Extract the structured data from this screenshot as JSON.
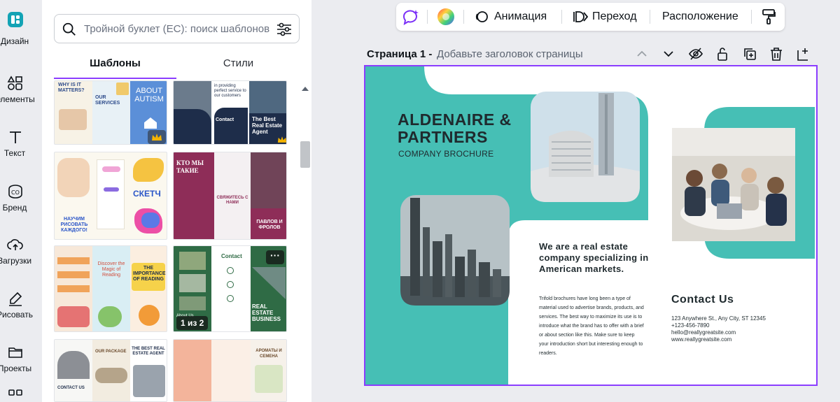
{
  "sidebar": {
    "items": [
      {
        "label": "Дизайн",
        "icon": "design-icon"
      },
      {
        "label": "Элементы",
        "icon": "elements-icon"
      },
      {
        "label": "Текст",
        "icon": "text-icon"
      },
      {
        "label": "Бренд",
        "icon": "brand-icon"
      },
      {
        "label": "Загрузки",
        "icon": "uploads-icon"
      },
      {
        "label": "Рисовать",
        "icon": "draw-icon"
      },
      {
        "label": "Проекты",
        "icon": "projects-icon"
      },
      {
        "label": "",
        "icon": "apps-icon"
      }
    ]
  },
  "panel": {
    "search_placeholder": "Тройной буклет (ЕС): поиск шаблонов",
    "tabs": [
      "Шаблоны",
      "Стили"
    ],
    "templates": [
      {
        "title": "ABOUT AUTISM",
        "lines": [
          "WHY IS IT MATTERS?",
          "OUR SERVICES"
        ],
        "premium": true
      },
      {
        "title": "The Best Real Estate Agent",
        "lines": [
          "in providing perfect service to our customers",
          "Contact"
        ],
        "premium": true
      },
      {
        "title": "СКЕТЧ",
        "lines": [
          "НАУЧИМ РИСОВАТЬ КАЖДОГО!",
          "СКЕТЧ"
        ],
        "premium": false
      },
      {
        "title": "КТО МЫ ТАКИЕ",
        "lines": [
          "СВЯЖИТЕСЬ С НАМИ",
          "ПАВЛОВ И ФРОЛОВ"
        ],
        "premium": false
      },
      {
        "title": "THE IMPORTANCE OF READING",
        "lines": [
          "Discover the Magic of Reading"
        ],
        "premium": false
      },
      {
        "title": "REAL ESTATE BUSINESS",
        "lines": [
          "Contact",
          "About Us"
        ],
        "premium": false,
        "badge": "1 из 2",
        "more": "···"
      },
      {
        "title": "THE BEST REAL ESTATE AGENT",
        "lines": [
          "OUR PACKAGE",
          "CONTACT US"
        ],
        "premium": false
      },
      {
        "title": "АРОМАТЫ И СЕМЕНА",
        "lines": [],
        "premium": false
      }
    ]
  },
  "toolbar": {
    "animation": "Анимация",
    "transition": "Переход",
    "position": "Расположение"
  },
  "page_header": {
    "name": "Страница 1 -",
    "title_placeholder": "Добавьте заголовок страницы"
  },
  "brochure": {
    "company": "ALDENAIRE & PARTNERS",
    "company_line1": "ALDENAIRE &",
    "company_line2": "PARTNERS",
    "subtitle": "COMPANY BROCHURE",
    "headline": "We are a real estate company specializing in American markets.",
    "body": "Trifold brochures have long been a type of material used to advertise brands, products, and services. The best way to maximize its use is to introduce what the brand has to offer with a brief or about section like this. Make sure to keep your introduction short but interesting enough to readers.",
    "contact_heading": "Contact Us",
    "address": "123 Anywhere St., Any City, ST 12345",
    "phone": "+123-456-7890",
    "email": "hello@reallygreatsite.com",
    "website": "www.reallygreatsite.com",
    "accent": "#46bfb5"
  },
  "colors": {
    "accent_purple": "#8b3dff",
    "teal": "#46bfb5"
  }
}
